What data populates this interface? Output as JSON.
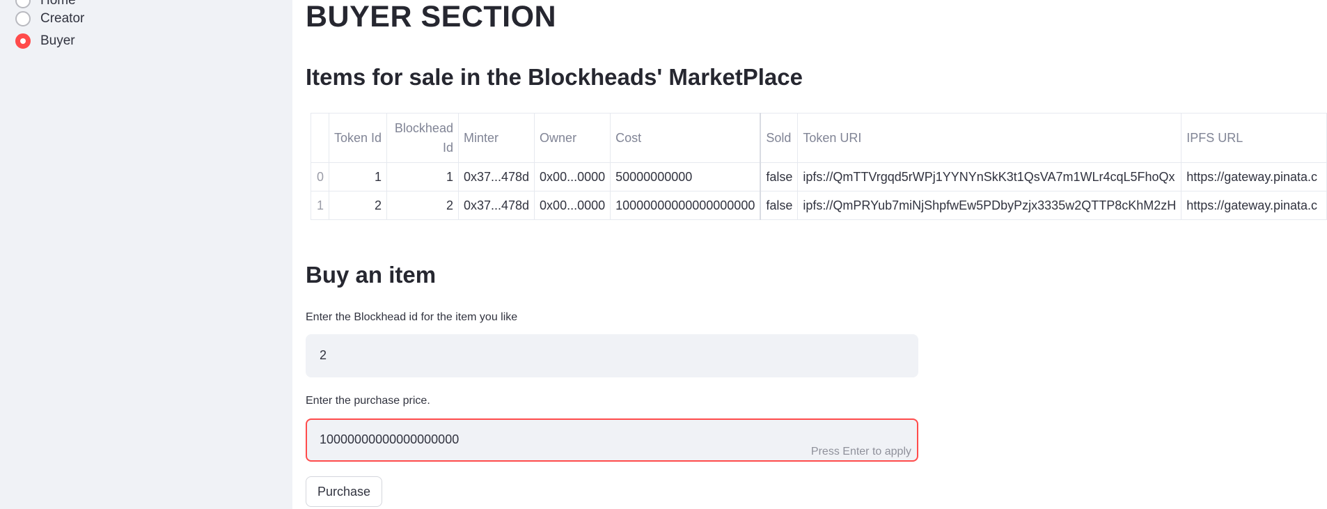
{
  "sidebar": {
    "items": [
      {
        "label": "Home",
        "selected": false
      },
      {
        "label": "Creator",
        "selected": false
      },
      {
        "label": "Buyer",
        "selected": true
      }
    ]
  },
  "main": {
    "title": "BUYER SECTION",
    "items_heading": "Items for sale in the Blockheads' MarketPlace",
    "table": {
      "headers": [
        "",
        "Token Id",
        "Blockhead Id",
        "Minter",
        "Owner",
        "Cost",
        "Sold",
        "Token URI",
        "IPFS URL"
      ],
      "rows": [
        [
          "0",
          "1",
          "1",
          "0x37...478d",
          "0x00...0000",
          "50000000000",
          "false",
          "ipfs://QmTTVrgqd5rWPj1YYNYnSkK3t1QsVA7m1WLr4cqL5FhoQx",
          "https://gateway.pinata.c"
        ],
        [
          "1",
          "2",
          "2",
          "0x37...478d",
          "0x00...0000",
          "10000000000000000000",
          "false",
          "ipfs://QmPRYub7miNjShpfwEw5PDbyPzjx3335w2QTTP8cKhM2zH",
          "https://gateway.pinata.c"
        ]
      ]
    },
    "buy_heading": "Buy an item",
    "blockhead_id_label": "Enter the Blockhead id for the item you like",
    "blockhead_id_value": "2",
    "price_label": "Enter the purchase price.",
    "price_value": "10000000000000000000",
    "price_hint": "Press Enter to apply",
    "purchase_button": "Purchase"
  },
  "colors": {
    "accent": "#ff4b4b",
    "sidebar_bg": "#f0f2f6",
    "input_bg": "#f0f2f6",
    "text": "#31333f"
  }
}
